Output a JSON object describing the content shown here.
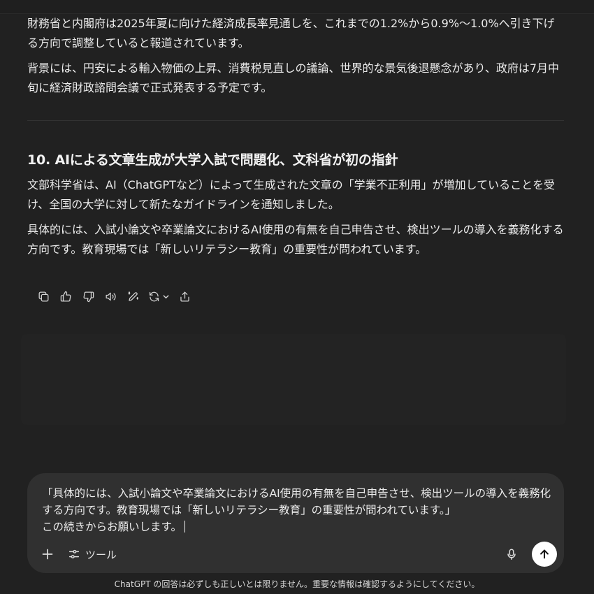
{
  "article": {
    "para_1": "財務省と内閣府は2025年夏に向けた経済成長率見通しを、これまでの1.2%から0.9%〜1.0%へ引き下げる方向で調整していると報道されています。",
    "para_2": "背景には、円安による輸入物価の上昇、消費税見直しの議論、世界的な景気後退懸念があり、政府は7月中旬に経済財政諮問会議で正式発表する予定です。",
    "heading": "10. AIによる文章生成が大学入試で問題化、文科省が初の指針",
    "para_3": "文部科学省は、AI（ChatGPTなど）によって生成された文章の「学業不正利用」が増加していることを受け、全国の大学に対して新たなガイドラインを通知しました。",
    "para_4": "具体的には、入試小論文や卒業論文におけるAI使用の有無を自己申告させ、検出ツールの導入を義務化する方向です。教育現場では「新しいリテラシー教育」の重要性が問われています。"
  },
  "actions": [
    {
      "name": "copy-icon"
    },
    {
      "name": "thumbs-up-icon"
    },
    {
      "name": "thumbs-down-icon"
    },
    {
      "name": "read-aloud-icon"
    },
    {
      "name": "edit-canvas-icon"
    },
    {
      "name": "regenerate-icon"
    },
    {
      "name": "share-icon"
    }
  ],
  "composer": {
    "text": "「具体的には、入試小論文や卒業論文におけるAI使用の有無を自己申告させ、検出ツールの導入を義務化する方向です。教育現場では「新しいリテラシー教育」の重要性が問われています。」\nこの続きからお願いします。",
    "tools_label": "ツール"
  },
  "disclaimer": "ChatGPT の回答は必ずしも正しいとは限りません。重要な情報は確認するようにしてください。",
  "colors": {
    "background": "#212121",
    "composer": "#303030",
    "text": "#ececec",
    "send_button": "#ffffff"
  }
}
